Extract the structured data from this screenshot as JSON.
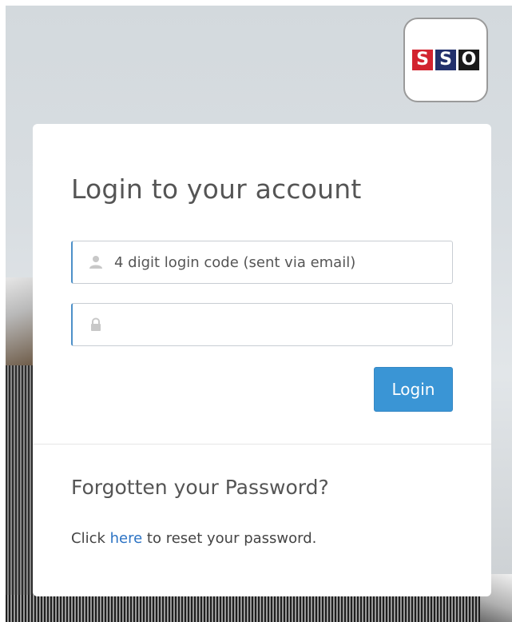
{
  "logo": {
    "letters": [
      "S",
      "S",
      "O"
    ],
    "colors": [
      "#d2232f",
      "#22306b",
      "#1a1a1a"
    ]
  },
  "login": {
    "title": "Login to your account",
    "code_placeholder": "4 digit login code (sent via email)",
    "code_icon": "user-icon",
    "password_placeholder": "",
    "password_icon": "lock-icon",
    "button_label": "Login",
    "accent": "#3a95d5"
  },
  "forgot": {
    "title": "Forgotten your Password?",
    "text_before": "Click ",
    "link_text": "here",
    "text_after": " to reset your password."
  }
}
